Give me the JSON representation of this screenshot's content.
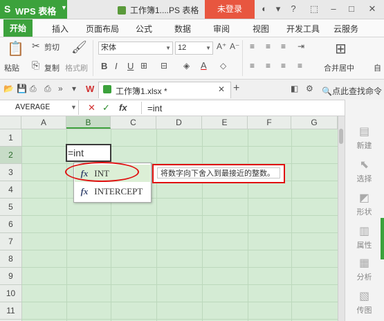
{
  "app": {
    "name": "WPS 表格",
    "document_title": "工作簿1....PS 表格",
    "login_label": "未登录"
  },
  "ribbon_tabs": [
    "开始",
    "插入",
    "页面布局",
    "公式",
    "数据",
    "审阅",
    "视图",
    "开发工具",
    "云服务"
  ],
  "ribbon": {
    "paste": "粘贴",
    "cut": "剪切",
    "copy": "复制",
    "format_painter": "格式刷",
    "font_name": "宋体",
    "font_size": "12",
    "merge_center": "合并居中",
    "auto": "自"
  },
  "doc_tab": {
    "label": "工作簿1.xlsx *"
  },
  "find_command": "点此查找命令",
  "formula_bar": {
    "name_box": "AVERAGE",
    "cancel": "✕",
    "confirm": "✓",
    "fx": "fx",
    "content": "=int"
  },
  "columns": [
    "A",
    "B",
    "C",
    "D",
    "E",
    "F",
    "G"
  ],
  "rows": [
    "1",
    "2",
    "3",
    "4",
    "5",
    "6",
    "7",
    "8",
    "9",
    "10",
    "11"
  ],
  "active_cell": {
    "ref": "B2",
    "value": "=int"
  },
  "autocomplete": [
    {
      "fx": "fx",
      "name": "INT"
    },
    {
      "fx": "fx",
      "name": "INTERCEPT"
    }
  ],
  "tooltip": "将数字向下舍入到最接近的整数。",
  "right_pane": [
    "新建",
    "选择",
    "形状",
    "属性",
    "分析",
    "传图"
  ],
  "colors": {
    "accent": "#3ca23c",
    "grid_bg": "#d4ebd4",
    "highlight": "#e01010",
    "login": "#e8563f"
  }
}
